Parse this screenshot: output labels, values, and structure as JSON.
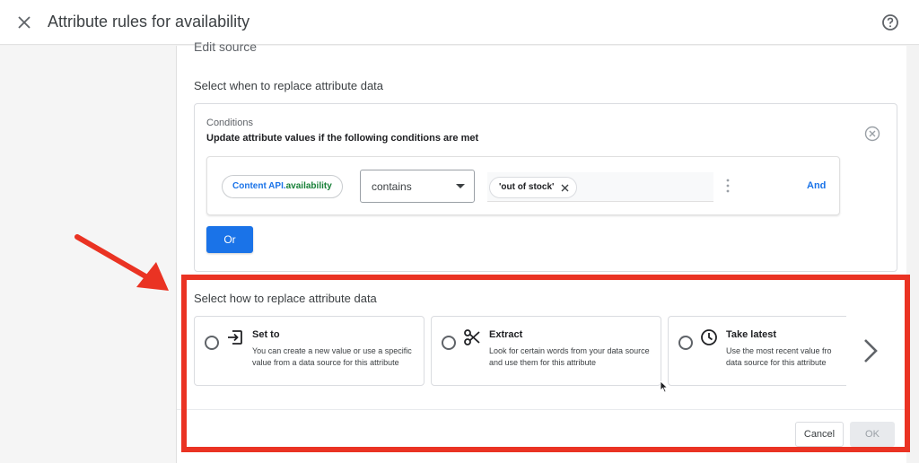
{
  "window": {
    "title": "Attribute rules for availability"
  },
  "panel": {
    "edit_source_label": "Edit source",
    "when_section_title": "Select when to replace attribute data",
    "how_section_title": "Select how to replace attribute data"
  },
  "conditions": {
    "label": "Conditions",
    "description": "Update attribute values if the following conditions are met",
    "rows": [
      {
        "attribute_prefix": "Content API.",
        "attribute_name": "availability",
        "operator": "contains",
        "value_chip": "'out of stock'",
        "and_label": "And"
      }
    ],
    "or_button": "Or"
  },
  "options": [
    {
      "title": "Set to",
      "icon": "set-to-icon",
      "description": "You can create a new value or use a specific value from a data source for this attribute"
    },
    {
      "title": "Extract",
      "icon": "scissors-icon",
      "description": "Look for certain words from your data source and use them for this attribute"
    },
    {
      "title": "Take latest",
      "icon": "clock-icon",
      "description": "Use the most recent value fro... data source for this attribute",
      "description_visible": "Use the most recent value fro",
      "description_line2": "data source for this attribute"
    }
  ],
  "footer": {
    "cancel_label": "Cancel",
    "ok_label": "OK"
  },
  "colors": {
    "accent": "#1a73e8",
    "annotation_red": "#ea3323",
    "attribute_green": "#188038"
  }
}
